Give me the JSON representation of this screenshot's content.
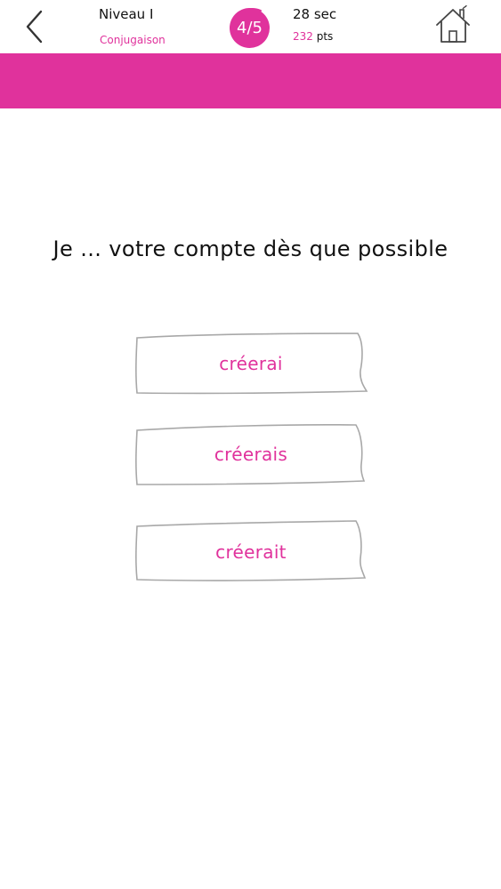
{
  "header": {
    "level_title": "Niveau I",
    "level_subtitle": "Conjugaison",
    "progress": "4/5",
    "timer": "28 sec",
    "score_value": "232",
    "score_unit": "pts",
    "back_icon": "chevron-left-icon",
    "home_icon": "home-icon"
  },
  "colors": {
    "accent": "#e0329c",
    "text": "#111111",
    "button_border": "#a8a8a8"
  },
  "question": {
    "text": "Je ... votre compte dès que possible"
  },
  "answers": [
    {
      "label": "créerai"
    },
    {
      "label": "créerais"
    },
    {
      "label": "créerait"
    }
  ]
}
